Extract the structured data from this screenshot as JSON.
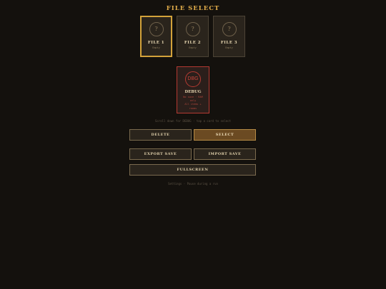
{
  "header": {
    "title": "FILE SELECT"
  },
  "slots": [
    {
      "name": "FILE 1",
      "status": "Empty",
      "icon_glyph": "?",
      "icon": "question-icon",
      "selected": true
    },
    {
      "name": "FILE 2",
      "status": "Empty",
      "icon_glyph": "?",
      "icon": "question-icon",
      "selected": false
    },
    {
      "name": "FILE 3",
      "status": "Empty",
      "icon_glyph": "?",
      "icon": "question-icon",
      "selected": false
    }
  ],
  "debug": {
    "badge": "DBG",
    "name": "DEBUG",
    "desc_line1": "No save · RAM",
    "desc_line2": "only",
    "desc_line3": "All items +",
    "desc_line4": "rooms"
  },
  "hints": {
    "scroll": "Scroll down for DEBUG · tap a card to select",
    "settings": "Settings · Pause during a run"
  },
  "buttons": {
    "delete": "DELETE",
    "select": "SELECT",
    "export": "EXPORT SAVE",
    "import": "IMPORT SAVE",
    "fullscreen": "FULLSCREEN"
  },
  "colors": {
    "background": "#14110d",
    "accent_gold": "#d3a23a",
    "debug_red": "#b53a32",
    "primary_button": "#6b4a22"
  }
}
